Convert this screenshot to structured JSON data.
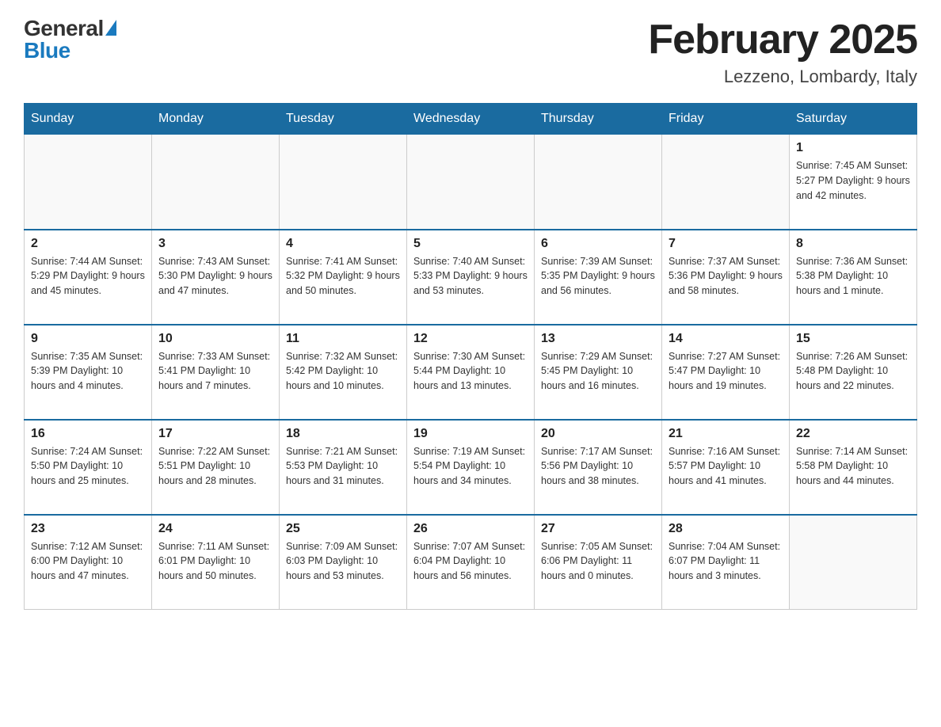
{
  "header": {
    "logo_general": "General",
    "logo_blue": "Blue",
    "title": "February 2025",
    "subtitle": "Lezzeno, Lombardy, Italy"
  },
  "weekdays": [
    "Sunday",
    "Monday",
    "Tuesday",
    "Wednesday",
    "Thursday",
    "Friday",
    "Saturday"
  ],
  "weeks": [
    [
      {
        "day": "",
        "info": ""
      },
      {
        "day": "",
        "info": ""
      },
      {
        "day": "",
        "info": ""
      },
      {
        "day": "",
        "info": ""
      },
      {
        "day": "",
        "info": ""
      },
      {
        "day": "",
        "info": ""
      },
      {
        "day": "1",
        "info": "Sunrise: 7:45 AM\nSunset: 5:27 PM\nDaylight: 9 hours\nand 42 minutes."
      }
    ],
    [
      {
        "day": "2",
        "info": "Sunrise: 7:44 AM\nSunset: 5:29 PM\nDaylight: 9 hours\nand 45 minutes."
      },
      {
        "day": "3",
        "info": "Sunrise: 7:43 AM\nSunset: 5:30 PM\nDaylight: 9 hours\nand 47 minutes."
      },
      {
        "day": "4",
        "info": "Sunrise: 7:41 AM\nSunset: 5:32 PM\nDaylight: 9 hours\nand 50 minutes."
      },
      {
        "day": "5",
        "info": "Sunrise: 7:40 AM\nSunset: 5:33 PM\nDaylight: 9 hours\nand 53 minutes."
      },
      {
        "day": "6",
        "info": "Sunrise: 7:39 AM\nSunset: 5:35 PM\nDaylight: 9 hours\nand 56 minutes."
      },
      {
        "day": "7",
        "info": "Sunrise: 7:37 AM\nSunset: 5:36 PM\nDaylight: 9 hours\nand 58 minutes."
      },
      {
        "day": "8",
        "info": "Sunrise: 7:36 AM\nSunset: 5:38 PM\nDaylight: 10 hours\nand 1 minute."
      }
    ],
    [
      {
        "day": "9",
        "info": "Sunrise: 7:35 AM\nSunset: 5:39 PM\nDaylight: 10 hours\nand 4 minutes."
      },
      {
        "day": "10",
        "info": "Sunrise: 7:33 AM\nSunset: 5:41 PM\nDaylight: 10 hours\nand 7 minutes."
      },
      {
        "day": "11",
        "info": "Sunrise: 7:32 AM\nSunset: 5:42 PM\nDaylight: 10 hours\nand 10 minutes."
      },
      {
        "day": "12",
        "info": "Sunrise: 7:30 AM\nSunset: 5:44 PM\nDaylight: 10 hours\nand 13 minutes."
      },
      {
        "day": "13",
        "info": "Sunrise: 7:29 AM\nSunset: 5:45 PM\nDaylight: 10 hours\nand 16 minutes."
      },
      {
        "day": "14",
        "info": "Sunrise: 7:27 AM\nSunset: 5:47 PM\nDaylight: 10 hours\nand 19 minutes."
      },
      {
        "day": "15",
        "info": "Sunrise: 7:26 AM\nSunset: 5:48 PM\nDaylight: 10 hours\nand 22 minutes."
      }
    ],
    [
      {
        "day": "16",
        "info": "Sunrise: 7:24 AM\nSunset: 5:50 PM\nDaylight: 10 hours\nand 25 minutes."
      },
      {
        "day": "17",
        "info": "Sunrise: 7:22 AM\nSunset: 5:51 PM\nDaylight: 10 hours\nand 28 minutes."
      },
      {
        "day": "18",
        "info": "Sunrise: 7:21 AM\nSunset: 5:53 PM\nDaylight: 10 hours\nand 31 minutes."
      },
      {
        "day": "19",
        "info": "Sunrise: 7:19 AM\nSunset: 5:54 PM\nDaylight: 10 hours\nand 34 minutes."
      },
      {
        "day": "20",
        "info": "Sunrise: 7:17 AM\nSunset: 5:56 PM\nDaylight: 10 hours\nand 38 minutes."
      },
      {
        "day": "21",
        "info": "Sunrise: 7:16 AM\nSunset: 5:57 PM\nDaylight: 10 hours\nand 41 minutes."
      },
      {
        "day": "22",
        "info": "Sunrise: 7:14 AM\nSunset: 5:58 PM\nDaylight: 10 hours\nand 44 minutes."
      }
    ],
    [
      {
        "day": "23",
        "info": "Sunrise: 7:12 AM\nSunset: 6:00 PM\nDaylight: 10 hours\nand 47 minutes."
      },
      {
        "day": "24",
        "info": "Sunrise: 7:11 AM\nSunset: 6:01 PM\nDaylight: 10 hours\nand 50 minutes."
      },
      {
        "day": "25",
        "info": "Sunrise: 7:09 AM\nSunset: 6:03 PM\nDaylight: 10 hours\nand 53 minutes."
      },
      {
        "day": "26",
        "info": "Sunrise: 7:07 AM\nSunset: 6:04 PM\nDaylight: 10 hours\nand 56 minutes."
      },
      {
        "day": "27",
        "info": "Sunrise: 7:05 AM\nSunset: 6:06 PM\nDaylight: 11 hours\nand 0 minutes."
      },
      {
        "day": "28",
        "info": "Sunrise: 7:04 AM\nSunset: 6:07 PM\nDaylight: 11 hours\nand 3 minutes."
      },
      {
        "day": "",
        "info": ""
      }
    ]
  ],
  "colors": {
    "header_bg": "#1a6ba0",
    "header_text": "#ffffff",
    "border": "#cccccc",
    "title_text": "#222222",
    "body_text": "#333333"
  }
}
